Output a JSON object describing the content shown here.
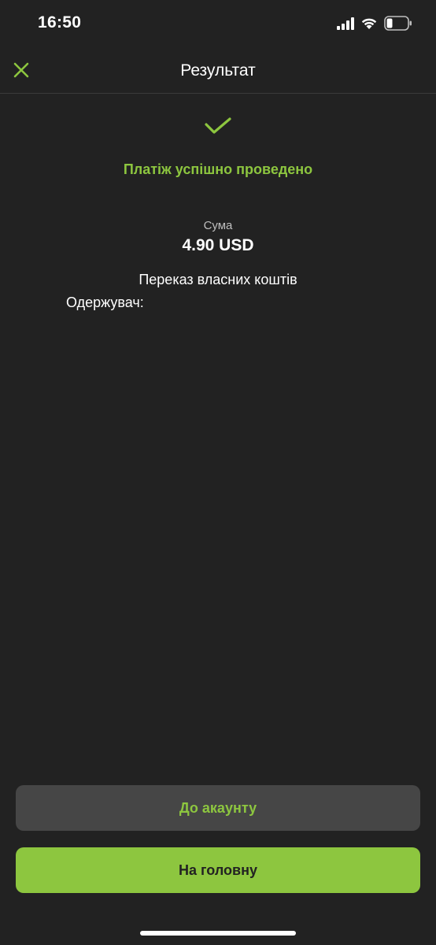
{
  "status_bar": {
    "time": "16:50",
    "icons": [
      "cellular-signal-icon",
      "wifi-icon",
      "battery-icon"
    ]
  },
  "nav": {
    "title": "Результат",
    "close_icon": "close-icon"
  },
  "result": {
    "icon": "checkmark-icon",
    "success_message": "Платіж успішно проведено",
    "amount_label": "Сума",
    "amount_value": "4.90 USD",
    "description": "Переказ власних коштів",
    "recipient": "Одержувач: "
  },
  "actions": {
    "account_button": "До акаунту",
    "home_button": "На головну"
  },
  "colors": {
    "background": "#222222",
    "accent": "#8dc63f",
    "secondary_button": "#464646"
  }
}
